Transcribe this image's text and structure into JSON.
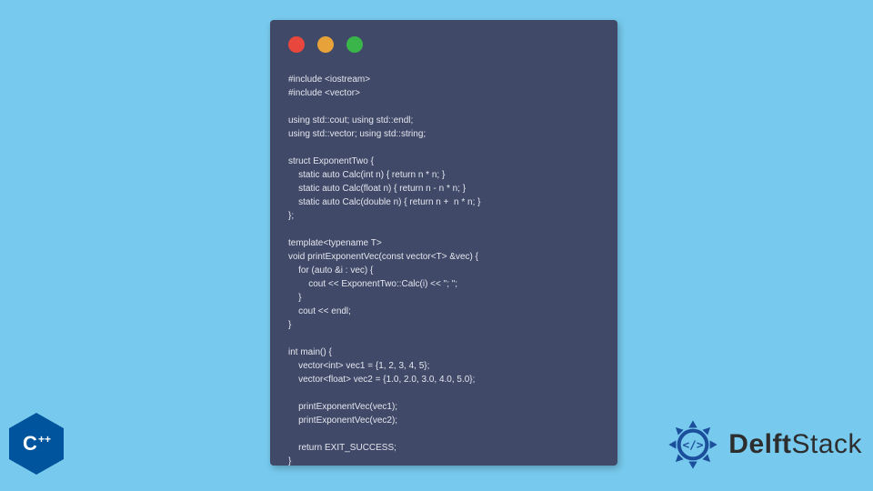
{
  "window": {
    "dots": [
      "red",
      "yellow",
      "green"
    ]
  },
  "code": "#include <iostream>\n#include <vector>\n\nusing std::cout; using std::endl;\nusing std::vector; using std::string;\n\nstruct ExponentTwo {\n    static auto Calc(int n) { return n * n; }\n    static auto Calc(float n) { return n - n * n; }\n    static auto Calc(double n) { return n +  n * n; }\n};\n\ntemplate<typename T>\nvoid printExponentVec(const vector<T> &vec) {\n    for (auto &i : vec) {\n        cout << ExponentTwo::Calc(i) << \"; \";\n    }\n    cout << endl;\n}\n\nint main() {\n    vector<int> vec1 = {1, 2, 3, 4, 5};\n    vector<float> vec2 = {1.0, 2.0, 3.0, 4.0, 5.0};\n\n    printExponentVec(vec1);\n    printExponentVec(vec2);\n\n    return EXIT_SUCCESS;\n}",
  "badges": {
    "cpp": "C",
    "cpp_plus": "++",
    "delft_bold": "Delft",
    "delft_light": "Stack"
  }
}
